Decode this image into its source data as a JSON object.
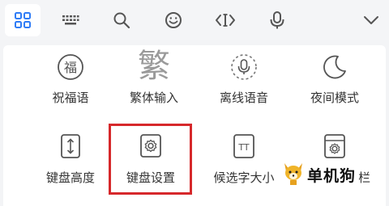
{
  "toolbar": {
    "buttons": [
      {
        "icon": "grid-icon",
        "active": true
      },
      {
        "icon": "keyboard-icon",
        "active": false
      },
      {
        "icon": "search-icon",
        "active": false
      },
      {
        "icon": "emoji-icon",
        "active": false
      },
      {
        "icon": "cursor-move-icon",
        "active": false
      },
      {
        "icon": "microphone-icon",
        "active": false
      },
      {
        "icon": "chevron-down-icon",
        "active": false
      }
    ]
  },
  "panel": {
    "row1": [
      {
        "label": "祝福语",
        "icon": "blessing-icon",
        "glyph": "福"
      },
      {
        "label": "繁体输入",
        "icon": "traditional-chinese-icon",
        "glyph": "繁"
      },
      {
        "label": "离线语音",
        "icon": "offline-voice-icon"
      },
      {
        "label": "夜间模式",
        "icon": "night-mode-icon"
      }
    ],
    "row2": [
      {
        "label": "键盘高度",
        "icon": "keyboard-height-icon"
      },
      {
        "label": "键盘设置",
        "icon": "keyboard-settings-icon",
        "highlighted": true
      },
      {
        "label": "候选字大小",
        "icon": "candidate-size-icon",
        "glyph": "TT"
      },
      {
        "label": "栏",
        "icon": "settings-partial-icon"
      }
    ]
  },
  "watermark": {
    "text": "单机狗"
  },
  "colors": {
    "accent": "#2f7cf6",
    "highlight": "#d6282b",
    "icon": "#555555"
  }
}
